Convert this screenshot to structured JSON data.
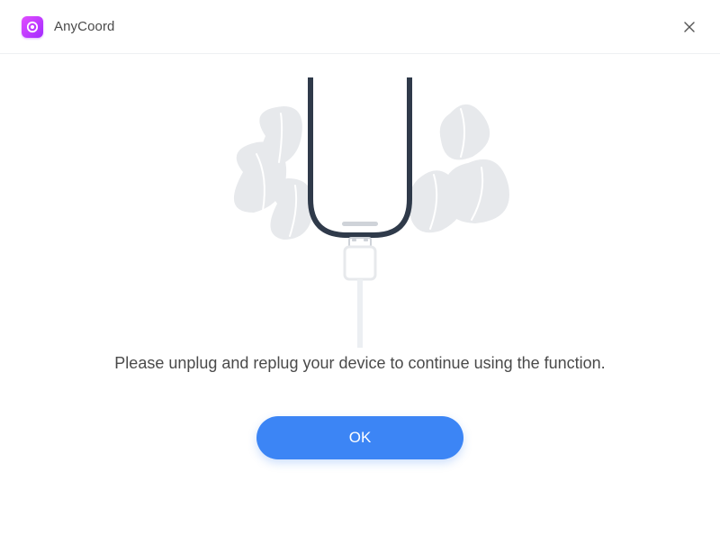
{
  "window": {
    "title": "AnyCoord"
  },
  "dialog": {
    "message": "Please unplug and replug your device to continue using the function.",
    "ok_label": "OK"
  }
}
